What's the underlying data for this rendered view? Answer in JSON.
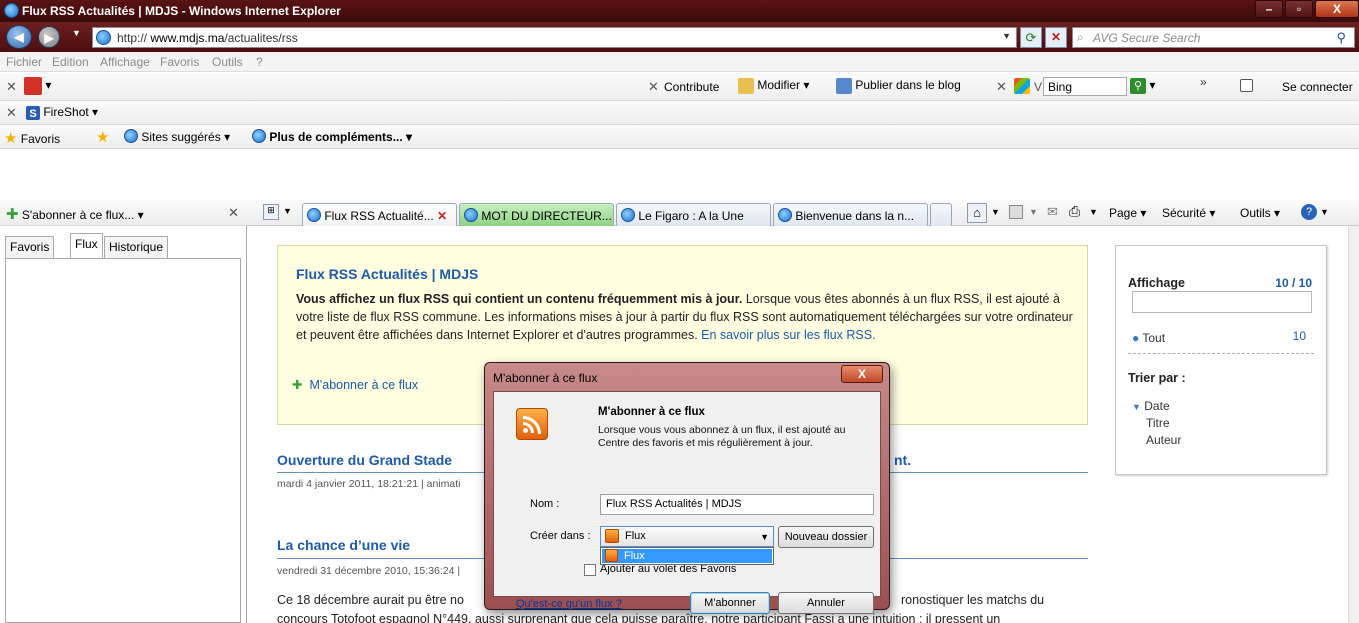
{
  "window": {
    "title": "Flux RSS Actualités | MDJS - Windows Internet Explorer",
    "minimize": "–",
    "maximize": "▫",
    "close": "X"
  },
  "address": {
    "url_prefix": "http://",
    "url_host": " www.mdjs.ma",
    "url_path": "/actualites/rss",
    "search_placeholder": "AVG Secure Search"
  },
  "menu": [
    "Fichier",
    "Edition",
    "Affichage",
    "Favoris",
    "Outils",
    "?"
  ],
  "toolbar1": {
    "contribute": "Contribute",
    "modifier": "Modifier",
    "publier": "Publier dans le blog",
    "bing_value": "Bing",
    "bing_prefix": "V",
    "se_connecter": "Se connecter"
  },
  "toolbar2": {
    "fireshot": "FireShot"
  },
  "favbar": {
    "favoris": "Favoris",
    "sites_suggeres": "Sites suggérés",
    "plus_complements": "Plus de compléments..."
  },
  "panel": {
    "subscribe": "S'abonner à ce flux...",
    "tabs": [
      "Favoris",
      "Flux",
      "Historique"
    ]
  },
  "tabs": [
    {
      "label": "Flux RSS Actualité..."
    },
    {
      "label": "MOT DU DIRECTEUR..."
    },
    {
      "label": "Le Figaro : A la Une"
    },
    {
      "label": "Bienvenue dans la n..."
    }
  ],
  "commandbar": {
    "page": "Page",
    "securite": "Sécurité",
    "outils": "Outils"
  },
  "feed": {
    "title": "Flux RSS Actualités | MDJS",
    "intro_bold": "Vous affichez un flux RSS qui contient un contenu fréquemment mis à jour.",
    "intro_rest": " Lorsque vous êtes abonnés à un flux RSS, il est ajouté à votre liste de flux RSS commune. Les informations mises à jour à partir du flux RSS sont automatiquement téléchargées sur votre ordinateur et peuvent être affichées dans Internet Explorer et d'autres programmes. ",
    "learn_more": "En savoir plus sur les flux RSS.",
    "subscribe_link": "M'abonner à ce flux"
  },
  "articles": [
    {
      "title_start": "Ouverture du Grand Stade",
      "title_end": "nt.",
      "meta": "mardi 4 janvier 2011, 18:21:21 | animati"
    },
    {
      "title_start": "La chance d’une vie",
      "title_end": "",
      "meta": "vendredi 31 décembre 2010, 15:36:24 |",
      "body_start": "Ce 18 décembre aurait pu être no",
      "body_end": "ronostiquer les matchs du",
      "body_line2": "concours Totofoot espagnol N°449, aussi surprenant que cela puisse paraître, notre participant Fassi a une intuition : il pressent un"
    }
  ],
  "sidebar": {
    "affichage": "Affichage",
    "count": "10 / 10",
    "tout": "Tout",
    "tout_count": "10",
    "trier": "Trier par :",
    "date": "Date",
    "titre": "Titre",
    "auteur": "Auteur"
  },
  "dialog": {
    "title": "M'abonner à ce flux",
    "close": "X",
    "heading": "M'abonner à ce flux",
    "description": "Lorsque vous vous abonnez à un flux, il est ajouté au Centre des favoris et mis régulièrement à jour.",
    "nom_label": "Nom :",
    "nom_value": "Flux RSS Actualités | MDJS",
    "creer_label": "Créer dans :",
    "creer_value": "Flux",
    "nouveau_dossier": "Nouveau dossier",
    "dropdown_option": "Flux",
    "checkbox_label": "Ajouter au volet des Favoris",
    "help_link": "Qu'est-ce qu'un flux ?",
    "subscribe_btn": "M'abonner",
    "cancel_btn": "Annuler"
  }
}
